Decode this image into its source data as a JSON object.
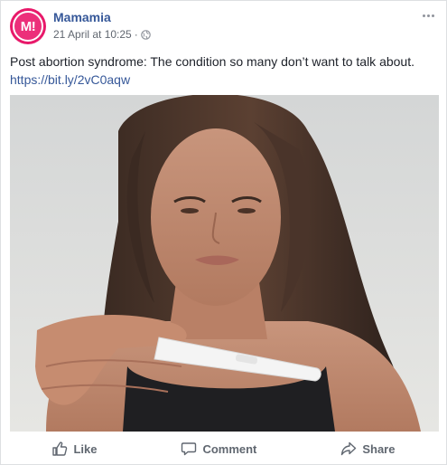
{
  "post": {
    "page_name": "Mamamia",
    "avatar_text": "M!",
    "timestamp": "21 April at 10:25",
    "separator": "·",
    "visibility_icon": "globe-icon",
    "text": "Post abortion syndrome: The condition so many don’t want to talk about.",
    "link": "https://bit.ly/2vC0aqw",
    "image_alt": "Woman with long dark hair looking at a pregnancy test"
  },
  "actions": {
    "like": "Like",
    "comment": "Comment",
    "share": "Share"
  },
  "colors": {
    "brand_pink": "#e8196a",
    "link_blue": "#365899",
    "muted_gray": "#606770"
  }
}
